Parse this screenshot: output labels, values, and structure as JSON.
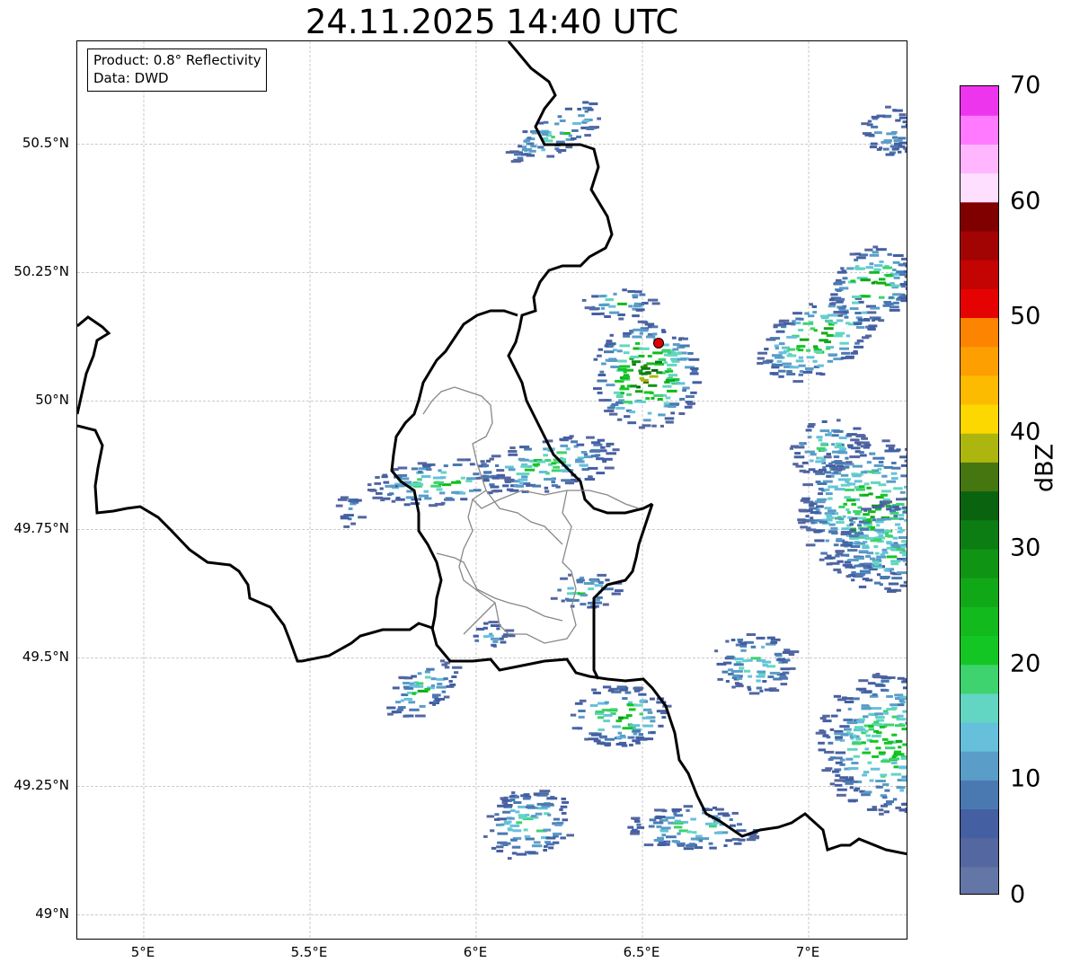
{
  "title": "24.11.2025 14:40 UTC",
  "info_box": {
    "product": "Product: 0.8° Reflectivity",
    "data": "Data: DWD"
  },
  "map": {
    "lon_labels": [
      "5°E",
      "5.5°E",
      "6°E",
      "6.5°E",
      "7°E"
    ],
    "lat_labels": [
      "50.5°N",
      "50.25°N",
      "50°N",
      "49.75°N",
      "49.5°N",
      "49.25°N",
      "49°N"
    ],
    "extent": {
      "lon": [
        4.8,
        7.3
      ],
      "lat": [
        48.95,
        50.7
      ]
    },
    "gridlines": true,
    "marker": {
      "lon": 6.55,
      "lat": 50.11,
      "color": "#e00000"
    }
  },
  "colorbar": {
    "label": "dBZ",
    "ticks": [
      "0",
      "10",
      "20",
      "30",
      "40",
      "50",
      "60",
      "70"
    ],
    "colors": [
      "#6476a6",
      "#5467a0",
      "#445fa2",
      "#4a79b2",
      "#5a9dc8",
      "#66c0dc",
      "#62d6c2",
      "#3ed36e",
      "#13c624",
      "#12ba1d",
      "#11a818",
      "#0f9414",
      "#0c7d12",
      "#0a640f",
      "#457610",
      "#acb60f",
      "#fdd700",
      "#fdbb00",
      "#fd9f00",
      "#fd8400",
      "#e40202",
      "#c40303",
      "#a20303",
      "#800000",
      "#ffdfff",
      "#ffb6ff",
      "#ff7aff",
      "#ec35ec"
    ]
  }
}
